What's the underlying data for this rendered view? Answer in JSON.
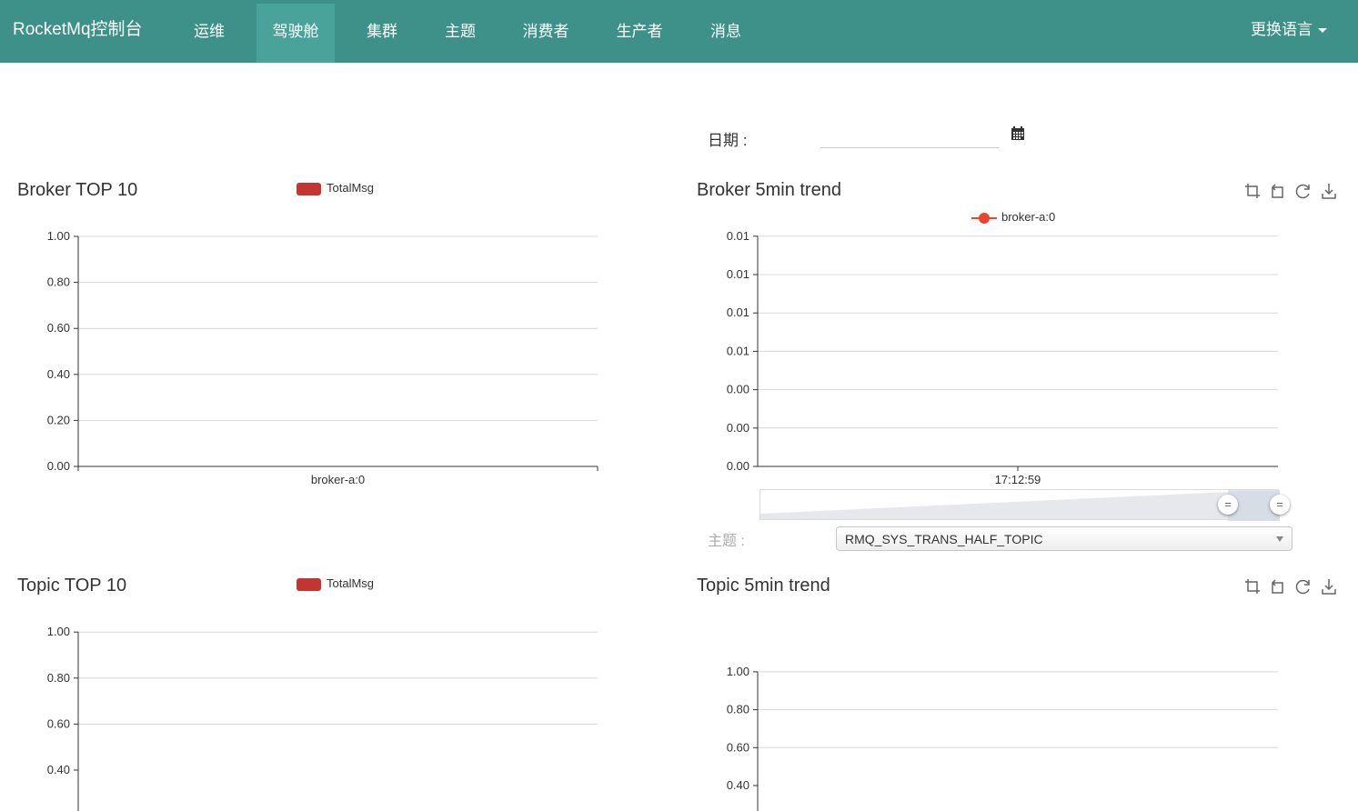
{
  "navbar": {
    "brand": "RocketMq控制台",
    "items": [
      {
        "label": "运维"
      },
      {
        "label": "驾驶舱"
      },
      {
        "label": "集群"
      },
      {
        "label": "主题"
      },
      {
        "label": "消费者"
      },
      {
        "label": "生产者"
      },
      {
        "label": "消息"
      }
    ],
    "active_item": "驾驶舱",
    "language_label": "更换语言"
  },
  "date": {
    "label": "日期 :",
    "value": "",
    "icon": "calendar-icon"
  },
  "broker_top": {
    "title": "Broker TOP 10",
    "legend": "TotalMsg"
  },
  "broker_trend": {
    "title": "Broker 5min trend",
    "legend": "broker-a:0",
    "toolbox_icons": [
      "zoom-icon",
      "zoom-reset-icon",
      "restore-icon",
      "save-image-icon"
    ]
  },
  "topic_filter": {
    "label": "主题 :",
    "selected": "RMQ_SYS_TRANS_HALF_TOPIC"
  },
  "topic_top": {
    "title": "Topic TOP 10",
    "legend": "TotalMsg"
  },
  "topic_trend": {
    "title": "Topic 5min trend",
    "toolbox_icons": [
      "zoom-icon",
      "zoom-reset-icon",
      "restore-icon",
      "save-image-icon"
    ]
  },
  "colors": {
    "navbar": "#3d9189",
    "navbar_active": "#4aa39a",
    "bar_series": "#c23531",
    "line_series": "#e8452c"
  },
  "chart_data": [
    {
      "id": "broker_top10",
      "type": "bar",
      "title": "Broker TOP 10",
      "categories": [
        "broker-a:0"
      ],
      "series": [
        {
          "name": "TotalMsg",
          "values": [
            0
          ]
        }
      ],
      "yticks": [
        "0.00",
        "0.20",
        "0.40",
        "0.60",
        "0.80",
        "1.00"
      ],
      "ylim": [
        0,
        1
      ],
      "legend_position": "top-center",
      "grid": true
    },
    {
      "id": "broker_5min_trend",
      "type": "line",
      "title": "Broker 5min trend",
      "x": [
        "17:12:59"
      ],
      "series": [
        {
          "name": "broker-a:0",
          "values": [
            0
          ]
        }
      ],
      "yticks": [
        "0.00",
        "0.00",
        "0.00",
        "0.01",
        "0.01",
        "0.01",
        "0.01"
      ],
      "legend_position": "top-center",
      "grid": true
    },
    {
      "id": "topic_top10",
      "type": "bar",
      "title": "Topic TOP 10",
      "categories": [],
      "series": [
        {
          "name": "TotalMsg",
          "values": []
        }
      ],
      "yticks": [
        "0.40",
        "0.60",
        "0.80",
        "1.00"
      ],
      "ylim": [
        0,
        1
      ],
      "legend_position": "top-center",
      "grid": true
    },
    {
      "id": "topic_5min_trend",
      "type": "line",
      "title": "Topic 5min trend",
      "x": [],
      "series": [],
      "yticks": [
        "0.40",
        "0.60",
        "0.80",
        "1.00"
      ],
      "ylim": [
        0,
        1
      ],
      "grid": true
    }
  ]
}
